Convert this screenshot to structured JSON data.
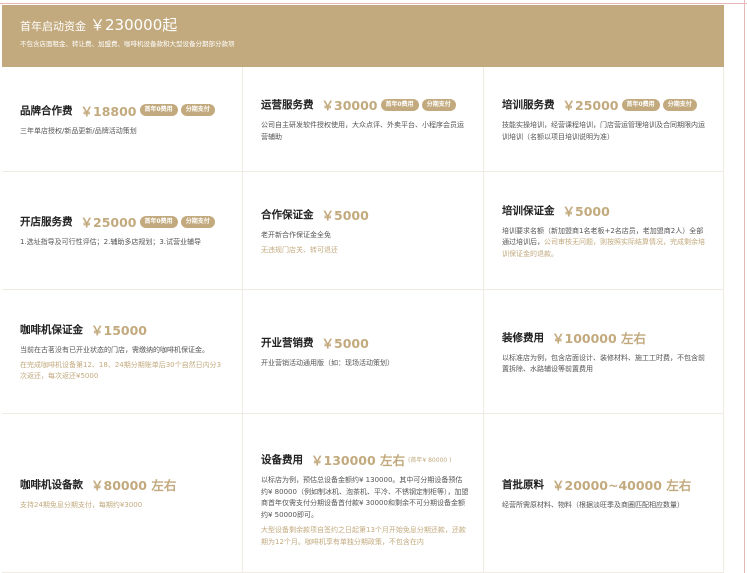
{
  "banner": {
    "label": "首年启动资金",
    "amount": "￥230000起",
    "subtitle": "不包含店面租金、转让费、加盟费、咖啡机设备款和大型设备分期部分款项"
  },
  "fees": {
    "brand": {
      "name": "品牌合作费",
      "price": "￥18800",
      "badges": [
        "首年0费用",
        "分期支付"
      ],
      "desc": "三年单店授权/新品更新/品牌活动策划"
    },
    "operation": {
      "name": "运营服务费",
      "price": "￥30000",
      "badges": [
        "首年0费用",
        "分期支付"
      ],
      "desc": "公司自主研发软件授权使用，大众点评、外卖平台、小程序会员运营辅助"
    },
    "training_service": {
      "name": "培训服务费",
      "price": "￥25000",
      "badges": [
        "首年0费用",
        "分期支付"
      ],
      "desc": "技能实操培训，经营课程培训，门店营运管理培训及合同期限内运训培训（名额以项目培训说明为准）"
    },
    "opening": {
      "name": "开店服务费",
      "price": "￥25000",
      "badges": [
        "首年0费用",
        "分期支付"
      ],
      "desc": "1.选址指导及可行性评估；2.辅助多店规划；3.试营业辅导"
    },
    "cooperation_deposit": {
      "name": "合作保证金",
      "price": "￥5000",
      "desc": "老开新合作保证金全免",
      "note": "无违规门店关、转可退还"
    },
    "training_deposit": {
      "name": "培训保证金",
      "price": "￥5000",
      "desc_a": "培训要求名额（新加盟商1名老板+2名店员，老加盟商2人）全部通过培训后，",
      "desc_b": "公司审核无问题，则按照实际结算情况，完成剩余培训保证金的退款。"
    },
    "coffee_deposit": {
      "name": "咖啡机保证金",
      "price": "￥15000",
      "desc": "当前在古茗没有已开业状态的门店，需缴纳的咖啡机保证金。",
      "note": "在完成咖啡机设备第12、18、24期分期账单后30个自然日内分3次返还，每次返还¥5000"
    },
    "marketing": {
      "name": "开业营销费",
      "price": "￥5000",
      "desc": "开业营销活动通用版（如：现场活动策划）"
    },
    "decoration": {
      "name": "装修费用",
      "price": "￥100000 左右",
      "desc": "以标准店为例，包含店面设计、装修材料、施工工时费，不包含前置拆除、水路辅设等前置费用"
    },
    "coffee_machine": {
      "name": "咖啡机设备款",
      "price": "￥80000 左右",
      "note": "支持24期免息分期支付，每期约¥3000"
    },
    "equipment": {
      "name": "设备费用",
      "price": "￥130000 左右",
      "price_note": "(首年¥ 80000 )",
      "desc": "以标店为例，预估总设备金额约¥ 130000。其中可分期设备预估约¥ 80000（例如制冰机、泡茶机、平冷、不锈钢定制柜等），加盟商首年仅需支付分期设备首付款¥ 30000和剩余不可分期设备金额约¥ 50000即可。",
      "note": "大型设备剩余款项自签约之日起第13个月开始免息分期还款，还款期为12个月。咖啡机享有单独分期政策，不包含在内"
    },
    "materials": {
      "name": "首批原料",
      "price": "￥20000~40000 左右",
      "desc": "经营所需原材料、物料（根据淡旺季及商圈匹配相应数量）"
    }
  },
  "colors": {
    "accent": "#c2aa7e",
    "banner_bg": "#c2aa7e",
    "text": "#333333"
  }
}
